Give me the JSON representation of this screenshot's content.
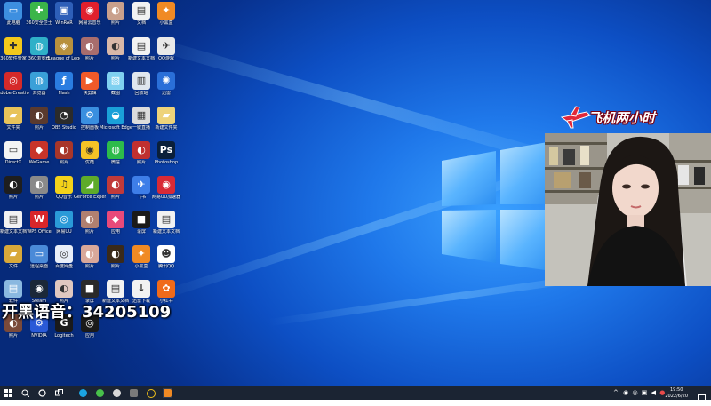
{
  "overlay_text": "开黑语音：34205109",
  "stream_banner": "飞机两小时",
  "taskbar": {
    "time": "19:50",
    "date": "2022/6/20"
  },
  "desktop_icons": [
    {
      "label": "此电脑",
      "color": "#3d8fe0",
      "glyph": "▭"
    },
    {
      "label": "360安全卫士",
      "color": "#3bb54a",
      "glyph": "✚"
    },
    {
      "label": "WinRAR",
      "color": "#2e5fb8",
      "glyph": "▣"
    },
    {
      "label": "网易云音乐",
      "color": "#e0202d",
      "glyph": "◉"
    },
    {
      "label": "照片",
      "color": "#c9a08c",
      "glyph": "◐"
    },
    {
      "label": "文档",
      "color": "#f2f2f2",
      "glyph": "▤"
    },
    {
      "label": "小黑盒",
      "color": "#f08a24",
      "glyph": "✦"
    },
    {
      "label": "360软件管家",
      "color": "#f3c81b",
      "glyph": "✚"
    },
    {
      "label": "360浏览器",
      "color": "#2fb0c8",
      "glyph": "◍"
    },
    {
      "label": "League of Legends",
      "color": "#b8913e",
      "glyph": "◈"
    },
    {
      "label": "照片",
      "color": "#a86d6d",
      "glyph": "◐"
    },
    {
      "label": "照片",
      "color": "#d9b8a8",
      "glyph": "◐"
    },
    {
      "label": "新建文本文档",
      "color": "#f2f2f2",
      "glyph": "▤"
    },
    {
      "label": "QQ游戏",
      "color": "#e9e9e9",
      "glyph": "✈"
    },
    {
      "label": "Adobe Creative",
      "color": "#d62a2a",
      "glyph": "◎"
    },
    {
      "label": "浏览器",
      "color": "#3aa0d8",
      "glyph": "◍"
    },
    {
      "label": "Flash",
      "color": "#2a7de1",
      "glyph": "ƒ"
    },
    {
      "label": "快剪辑",
      "color": "#f05a2a",
      "glyph": "▶"
    },
    {
      "label": "截图",
      "color": "#7fd0f0",
      "glyph": "▧"
    },
    {
      "label": "回收站",
      "color": "#dfe6ee",
      "glyph": "▥"
    },
    {
      "label": "迅雷",
      "color": "#2a6fd8",
      "glyph": "✺"
    },
    {
      "label": "文件夹",
      "color": "#e8c35a",
      "glyph": "▰"
    },
    {
      "label": "照片",
      "color": "#5a3a2e",
      "glyph": "◐"
    },
    {
      "label": "OBS Studio",
      "color": "#2b2b2b",
      "glyph": "◔"
    },
    {
      "label": "控制面板",
      "color": "#3a8fe0",
      "glyph": "⚙"
    },
    {
      "label": "Microsoft Edge",
      "color": "#1aa0d8",
      "glyph": "◒"
    },
    {
      "label": "一键直播",
      "color": "#dcdcdc",
      "glyph": "▦"
    },
    {
      "label": "新建文件夹",
      "color": "#eed37a",
      "glyph": "▰"
    },
    {
      "label": "DirectX",
      "color": "#f4f4f4",
      "glyph": "▭"
    },
    {
      "label": "WeGame",
      "color": "#c8342a",
      "glyph": "◆"
    },
    {
      "label": "照片",
      "color": "#a8362a",
      "glyph": "◐"
    },
    {
      "label": "优酷",
      "color": "#f5c326",
      "glyph": "◉"
    },
    {
      "label": "微信",
      "color": "#2dbb4a",
      "glyph": "◍"
    },
    {
      "label": "照片",
      "color": "#c03030",
      "glyph": "◐"
    },
    {
      "label": "Photoshop",
      "color": "#0a1f3a",
      "glyph": "Ps"
    },
    {
      "label": "照片",
      "color": "#1e1e1e",
      "glyph": "◐"
    },
    {
      "label": "照片",
      "color": "#8a8a8a",
      "glyph": "◐"
    },
    {
      "label": "QQ音乐",
      "color": "#f3d21a",
      "glyph": "♫"
    },
    {
      "label": "GeForce Experience",
      "color": "#5eab2a",
      "glyph": "◢"
    },
    {
      "label": "照片",
      "color": "#c03a3a",
      "glyph": "◐"
    },
    {
      "label": "飞书",
      "color": "#3e7ee8",
      "glyph": "✈"
    },
    {
      "label": "网易UU加速器",
      "color": "#d82a36",
      "glyph": "◉"
    },
    {
      "label": "新建文本文档",
      "color": "#f2f2f2",
      "glyph": "▤"
    },
    {
      "label": "WPS Office",
      "color": "#d8262a",
      "glyph": "W"
    },
    {
      "label": "网易UU",
      "color": "#2a9ad8",
      "glyph": "◎"
    },
    {
      "label": "照片",
      "color": "#b08070",
      "glyph": "◐"
    },
    {
      "label": "应用",
      "color": "#e84a7a",
      "glyph": "◆"
    },
    {
      "label": "录屏",
      "color": "#1a1a1a",
      "glyph": "■"
    },
    {
      "label": "新建文本文档",
      "color": "#f2f2f2",
      "glyph": "▤"
    },
    {
      "label": "文件",
      "color": "#d8a83a",
      "glyph": "▰"
    },
    {
      "label": "远程桌面",
      "color": "#4a8ad8",
      "glyph": "▭"
    },
    {
      "label": "百度网盘",
      "color": "#e8eef8",
      "glyph": "◎"
    },
    {
      "label": "照片",
      "color": "#d9a89a",
      "glyph": "◐"
    },
    {
      "label": "照片",
      "color": "#3a2a1a",
      "glyph": "◐"
    },
    {
      "label": "小黑盒",
      "color": "#f08a24",
      "glyph": "✦"
    },
    {
      "label": "腾讯QQ",
      "color": "#ffffff",
      "glyph": "☻"
    },
    {
      "label": "软件",
      "color": "#8ab8e0",
      "glyph": "▤"
    },
    {
      "label": "Steam",
      "color": "#1b2838",
      "glyph": "◉"
    },
    {
      "label": "照片",
      "color": "#e0c8c0",
      "glyph": "◐"
    },
    {
      "label": "录屏",
      "color": "#2a2a2a",
      "glyph": "■"
    },
    {
      "label": "新建文本文档",
      "color": "#f2f2f2",
      "glyph": "▤"
    },
    {
      "label": "迅雷下载",
      "color": "#f2f2f2",
      "glyph": "↓"
    },
    {
      "label": "小红书",
      "color": "#f06a1a",
      "glyph": "✿"
    },
    {
      "label": "照片",
      "color": "#7a4a3a",
      "glyph": "◐"
    },
    {
      "label": "NVIDIA",
      "color": "#2a5ad8",
      "glyph": "⚙"
    },
    {
      "label": "Logitech",
      "color": "#1a1a1a",
      "glyph": "G"
    },
    {
      "label": "应用",
      "color": "#1a1a1a",
      "glyph": "◎"
    }
  ]
}
